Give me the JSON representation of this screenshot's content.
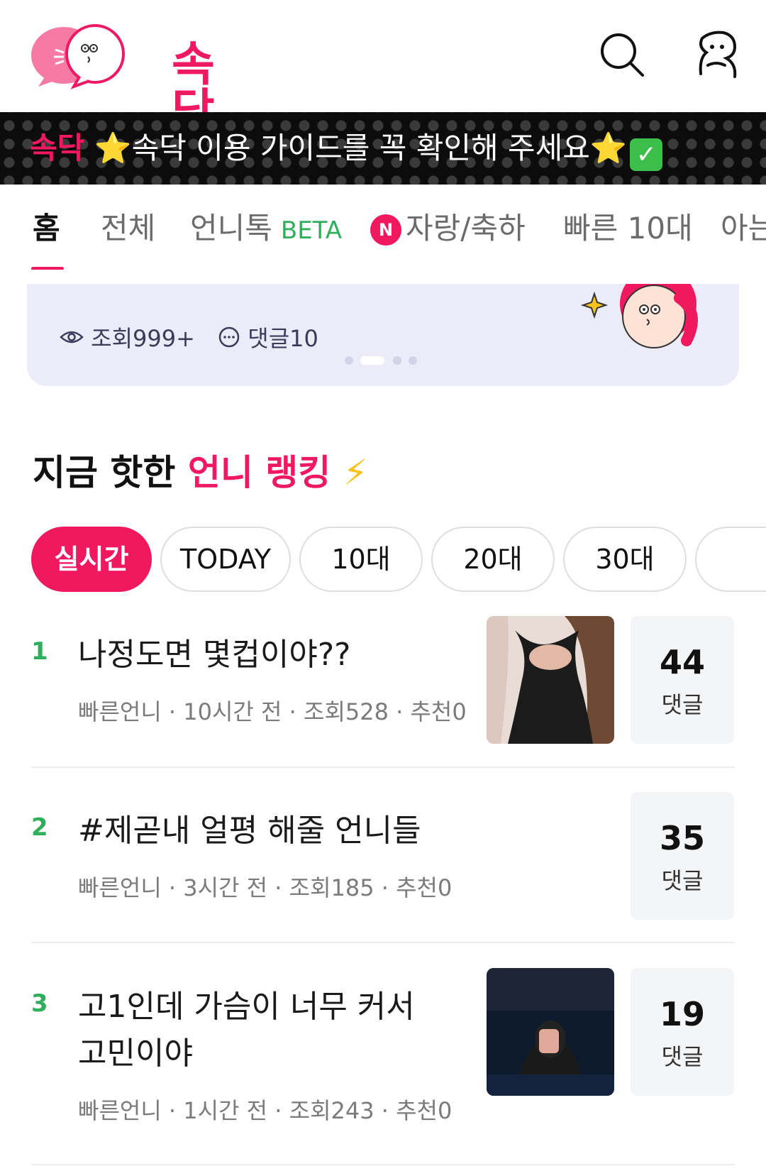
{
  "header": {
    "logo_text": "속닥",
    "search_icon": "search-icon",
    "profile_icon": "user-profile-icon"
  },
  "notice": {
    "tag": "속닥",
    "text_before": "⭐속닥 이용 가이드를 꼭 확인해 주세요⭐",
    "check": "✓"
  },
  "tabs": [
    {
      "label": "홈"
    },
    {
      "label": "전체"
    },
    {
      "label": "언니톡",
      "badge": "BETA"
    },
    {
      "label": "자랑/축하",
      "new_badge": "N"
    },
    {
      "label": "빠른 10대"
    },
    {
      "label": "아는"
    }
  ],
  "slider": {
    "views": "조회999+",
    "comments": "댓글10",
    "page_index": 2,
    "page_count": 4
  },
  "ranking": {
    "title_prefix": "지금 핫한 ",
    "title_highlight": "언니 랭킹",
    "title_icon": "⚡"
  },
  "chips": [
    "실시간",
    "TODAY",
    "10대",
    "20대",
    "30대"
  ],
  "posts": [
    {
      "rank": "1",
      "title": "나정도면 몇컵이야??",
      "meta": "빠른언니 · 10시간 전 · 조회528 · 추천0",
      "comments": "44",
      "comments_label": "댓글"
    },
    {
      "rank": "2",
      "title": "#제곧내 얼평 해줄 언니들",
      "meta": "빠른언니 · 3시간 전 · 조회185 · 추천0",
      "comments": "35",
      "comments_label": "댓글"
    },
    {
      "rank": "3",
      "title": "고1인데 가슴이 너무 커서 고민이야",
      "meta": "빠른언니 · 1시간 전 · 조회243 · 추천0",
      "comments": "19",
      "comments_label": "댓글"
    }
  ],
  "colors": {
    "brand": "#f0185f",
    "rank_green": "#2fae5c",
    "banner_bg": "#0c0c0c",
    "card_bg": "#ecebf8"
  }
}
